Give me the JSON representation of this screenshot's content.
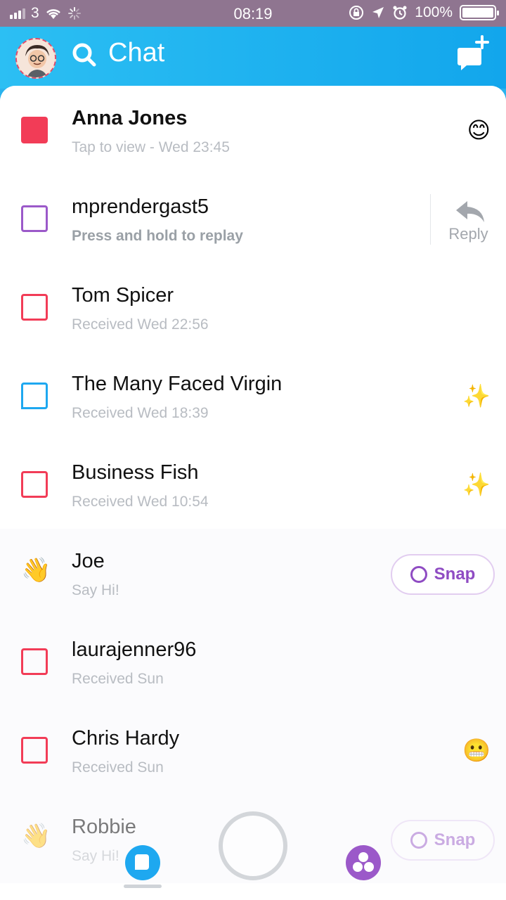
{
  "status_bar": {
    "carrier": "3",
    "time": "08:19",
    "battery": "100%"
  },
  "header": {
    "title": "Chat"
  },
  "chats": [
    {
      "name": "Anna Jones",
      "status": "Tap to view - Wed 23:45",
      "indicator": "filled-red-square",
      "emoji": "😊"
    },
    {
      "name": "mprendergast5",
      "status": "Press and hold to replay",
      "indicator": "purple-square-outline",
      "action": "Reply"
    },
    {
      "name": "Tom Spicer",
      "status": "Received Wed 22:56",
      "indicator": "red-square-outline"
    },
    {
      "name": "The Many Faced Virgin",
      "status": "Received Wed 18:39",
      "indicator": "blue-chat-outline",
      "emoji": "✨"
    },
    {
      "name": "Business Fish",
      "status": "Received Wed 10:54",
      "indicator": "red-square-outline",
      "emoji": "✨"
    },
    {
      "name": "Joe",
      "status": "Say Hi!",
      "indicator": "wave-emoji",
      "indicator_emoji": "👋",
      "action": "Snap"
    },
    {
      "name": "laurajenner96",
      "status": "Received Sun",
      "indicator": "red-square-outline"
    },
    {
      "name": "Chris Hardy",
      "status": "Received Sun",
      "indicator": "red-square-outline",
      "emoji": "😬"
    },
    {
      "name": "Robbie",
      "status": "Say Hi!",
      "indicator": "wave-emoji",
      "indicator_emoji": "👋",
      "action": "Snap"
    }
  ],
  "colors": {
    "header_blue": "#12a6ec",
    "snap_red": "#f23c57",
    "chat_blue": "#1ea8f0",
    "purple": "#9b59c9"
  }
}
